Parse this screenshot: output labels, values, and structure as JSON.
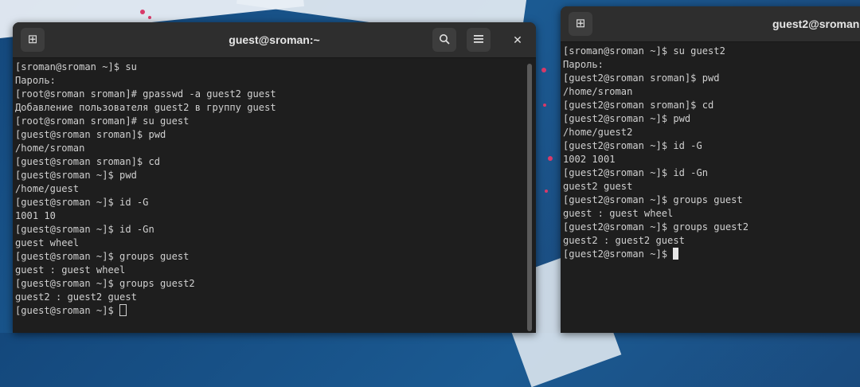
{
  "window_left": {
    "title": "guest@sroman:~",
    "lines": [
      "[sroman@sroman ~]$ su",
      "Пароль:",
      "[root@sroman sroman]# gpasswd -a guest2 guest",
      "Добавление пользователя guest2 в группу guest",
      "[root@sroman sroman]# su guest",
      "[guest@sroman sroman]$ pwd",
      "/home/sroman",
      "[guest@sroman sroman]$ cd",
      "[guest@sroman ~]$ pwd",
      "/home/guest",
      "[guest@sroman ~]$ id -G",
      "1001 10",
      "[guest@sroman ~]$ id -Gn",
      "guest wheel",
      "[guest@sroman ~]$ groups guest",
      "guest : guest wheel",
      "[guest@sroman ~]$ groups guest2",
      "guest2 : guest2 guest"
    ],
    "prompt": "[guest@sroman ~]$ "
  },
  "window_right": {
    "title": "guest2@sroman",
    "lines": [
      "[sroman@sroman ~]$ su guest2",
      "Пароль:",
      "[guest2@sroman sroman]$ pwd",
      "/home/sroman",
      "[guest2@sroman sroman]$ cd",
      "[guest2@sroman ~]$ pwd",
      "/home/guest2",
      "[guest2@sroman ~]$ id -G",
      "1002 1001",
      "[guest2@sroman ~]$ id -Gn",
      "guest2 guest",
      "[guest2@sroman ~]$ groups guest",
      "guest : guest wheel",
      "[guest2@sroman ~]$ groups guest2",
      "guest2 : guest2 guest"
    ],
    "prompt": "[guest2@sroman ~]$ "
  },
  "icons": {
    "new_tab": "new-tab-icon",
    "search": "search-icon",
    "menu": "hamburger-menu-icon",
    "close": "close-icon"
  }
}
